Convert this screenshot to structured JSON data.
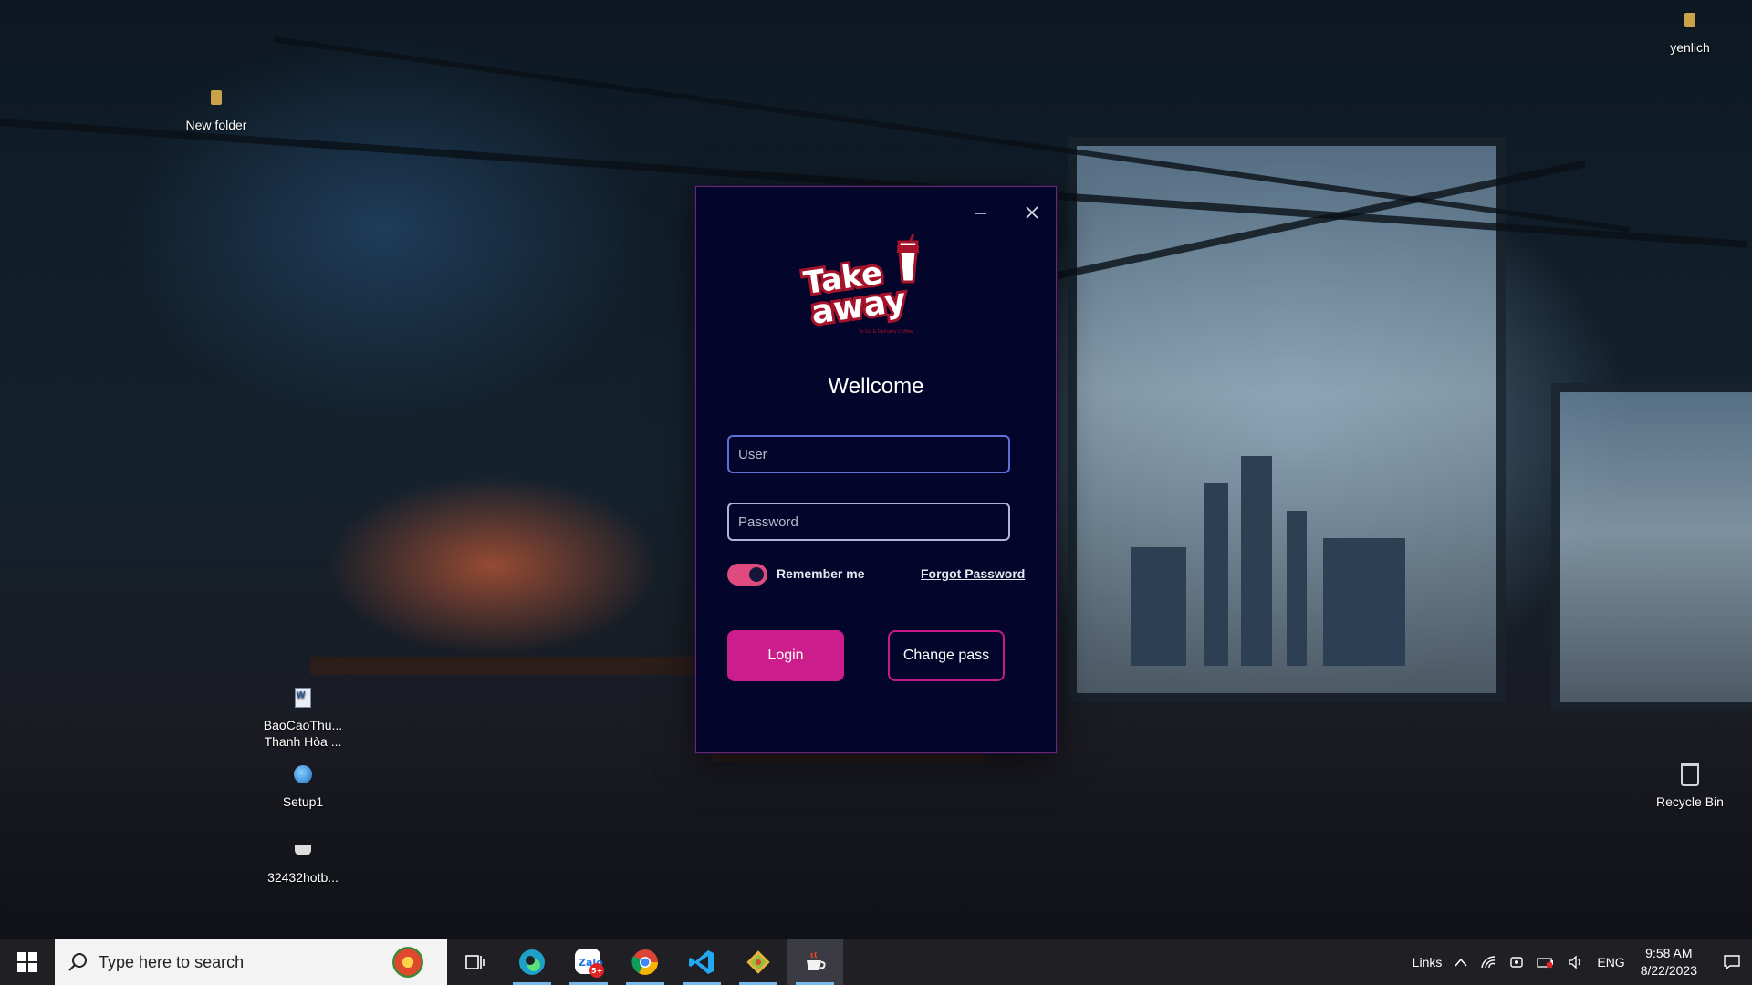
{
  "desktop": {
    "icons": [
      {
        "label": "New folder",
        "icon": "folder-icon"
      },
      {
        "label": "yenlich",
        "icon": "folder-icon"
      },
      {
        "label": "BaoCaoThu... Thanh Hòa ...",
        "icon": "word-document-icon"
      },
      {
        "label": "Setup1",
        "icon": "setup-icon"
      },
      {
        "label": "32432hotb...",
        "icon": "java-cup-icon"
      },
      {
        "label": "Recycle Bin",
        "icon": "recycle-bin-icon"
      }
    ]
  },
  "login": {
    "logo_line1": "Take",
    "logo_line2": "away",
    "logo_tagline": "To Go & Delivery Coffee",
    "title": "Wellcome",
    "user_placeholder": "User",
    "password_placeholder": "Password",
    "remember_label": "Remember me",
    "remember_checked": true,
    "forgot_label": "Forgot Password",
    "login_label": "Login",
    "change_label": "Change pass",
    "accent": "#cc1d8c",
    "background": "#03062a"
  },
  "taskbar": {
    "search_placeholder": "Type here to search",
    "apps": [
      "edge-icon",
      "zalo-icon",
      "chrome-icon",
      "vscode-icon",
      "git-icon",
      "java-cup-icon"
    ],
    "zalo_badge": "5+",
    "links_label": "Links",
    "language": "ENG",
    "time": "9:58 AM",
    "date": "8/22/2023"
  }
}
